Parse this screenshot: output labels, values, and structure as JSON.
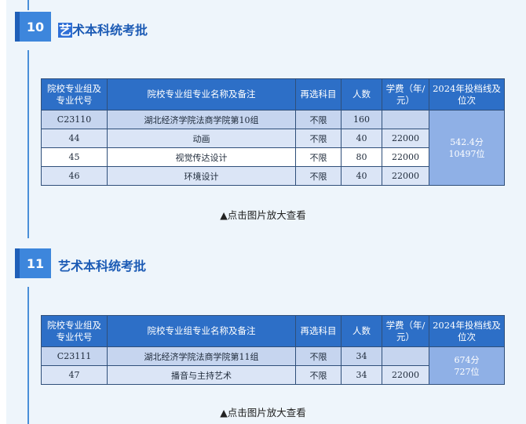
{
  "sections": [
    {
      "number": "10",
      "title_selected": "艺",
      "title_rest": "术本科统考批",
      "headers": [
        "院校专业组及专业代号",
        "院校专业组专业名称及备注",
        "再选科目",
        "人数",
        "学费（年/元）",
        "2024年投档线及位次"
      ],
      "group_row": {
        "code": "C23110",
        "name": "湖北经济学院法商学院第10组",
        "subject": "不限",
        "count": "160",
        "fee": ""
      },
      "rank_score": "542.4分",
      "rank_position": "10497位",
      "rows": [
        {
          "code": "44",
          "name": "动画",
          "subject": "不限",
          "count": "40",
          "fee": "22000"
        },
        {
          "code": "45",
          "name": "视觉传达设计",
          "subject": "不限",
          "count": "80",
          "fee": "22000"
        },
        {
          "code": "46",
          "name": "环境设计",
          "subject": "不限",
          "count": "40",
          "fee": "22000"
        }
      ],
      "caption": "▲点击图片放大查看"
    },
    {
      "number": "11",
      "title": "艺术本科统考批",
      "headers": [
        "院校专业组及专业代号",
        "院校专业组专业名称及备注",
        "再选科目",
        "人数",
        "学费（年/元）",
        "2024年投档线及位次"
      ],
      "group_row": {
        "code": "C23111",
        "name": "湖北经济学院法商学院第11组",
        "subject": "不限",
        "count": "34",
        "fee": ""
      },
      "rank_score": "674分",
      "rank_position": "727位",
      "rows": [
        {
          "code": "47",
          "name": "播音与主持艺术",
          "subject": "不限",
          "count": "34",
          "fee": "22000"
        }
      ],
      "caption": "▲点击图片放大查看"
    }
  ],
  "colors": {
    "header_bg": "#2d6fc7",
    "badge_bg": "#3d86dc",
    "title_color": "#1c5bb5",
    "rank_bg": "#8fb0e6",
    "panel_bg": "#eef5fb"
  }
}
